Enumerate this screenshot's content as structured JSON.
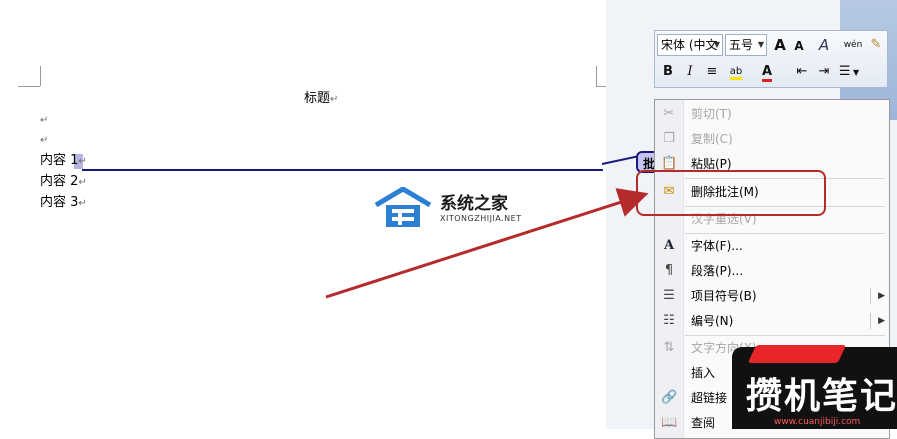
{
  "document": {
    "title_line": "标题",
    "para_mark": "↵",
    "lines": [
      "内容 1",
      "内容 2",
      "内容 3"
    ],
    "comment_tag": "批"
  },
  "mini_toolbar": {
    "font_name": "宋体 (中文",
    "font_size": "五号",
    "buttons": {
      "grow_font": "A",
      "shrink_font": "A",
      "styles": "A",
      "phonetic": "wén",
      "bold": "B",
      "italic": "I",
      "center": "≡",
      "highlight": "ab",
      "font_color": "A",
      "decrease_indent": "⇤",
      "increase_indent": "⇥",
      "bullets": "☰"
    }
  },
  "context_menu": {
    "items": [
      {
        "label": "剪切(T)",
        "icon": "scissors-icon",
        "glyph": "✂",
        "disabled": true
      },
      {
        "label": "复制(C)",
        "icon": "copy-icon",
        "glyph": "❐",
        "disabled": true
      },
      {
        "label": "粘贴(P)",
        "icon": "paste-icon",
        "glyph": "📋",
        "disabled": false
      },
      {
        "label": "删除批注(M)",
        "icon": "delete-comment-icon",
        "glyph": "✉",
        "disabled": false
      },
      {
        "label": "汉字重选(V)",
        "icon": "",
        "glyph": "",
        "disabled": true
      },
      {
        "label": "字体(F)...",
        "icon": "font-icon",
        "glyph": "A",
        "disabled": false
      },
      {
        "label": "段落(P)...",
        "icon": "paragraph-icon",
        "glyph": "¶",
        "disabled": false
      },
      {
        "label": "项目符号(B)",
        "icon": "bullets-icon",
        "glyph": "☰",
        "disabled": false,
        "submenu": true
      },
      {
        "label": "编号(N)",
        "icon": "numbering-icon",
        "glyph": "☷",
        "disabled": false,
        "submenu": true
      },
      {
        "label": "文字方向(X)...",
        "icon": "text-direction-icon",
        "glyph": "⇅",
        "disabled": true
      },
      {
        "label": "插入",
        "icon": "",
        "glyph": "",
        "disabled": false
      },
      {
        "label": "超链接",
        "icon": "hyperlink-icon",
        "glyph": "🔗",
        "disabled": false
      },
      {
        "label": "查阅",
        "icon": "lookup-icon",
        "glyph": "📖",
        "disabled": false
      }
    ],
    "submenu_arrow": "▶"
  },
  "watermarks": {
    "site1_name": "系统之家",
    "site1_url": "XITONGZHIJIA.NET",
    "site2_name": "攒机笔记",
    "site2_url": "www.cuanjibiji.com"
  },
  "colors": {
    "comment_line": "#1a1a7a",
    "annotation_red": "#b52a2a"
  }
}
